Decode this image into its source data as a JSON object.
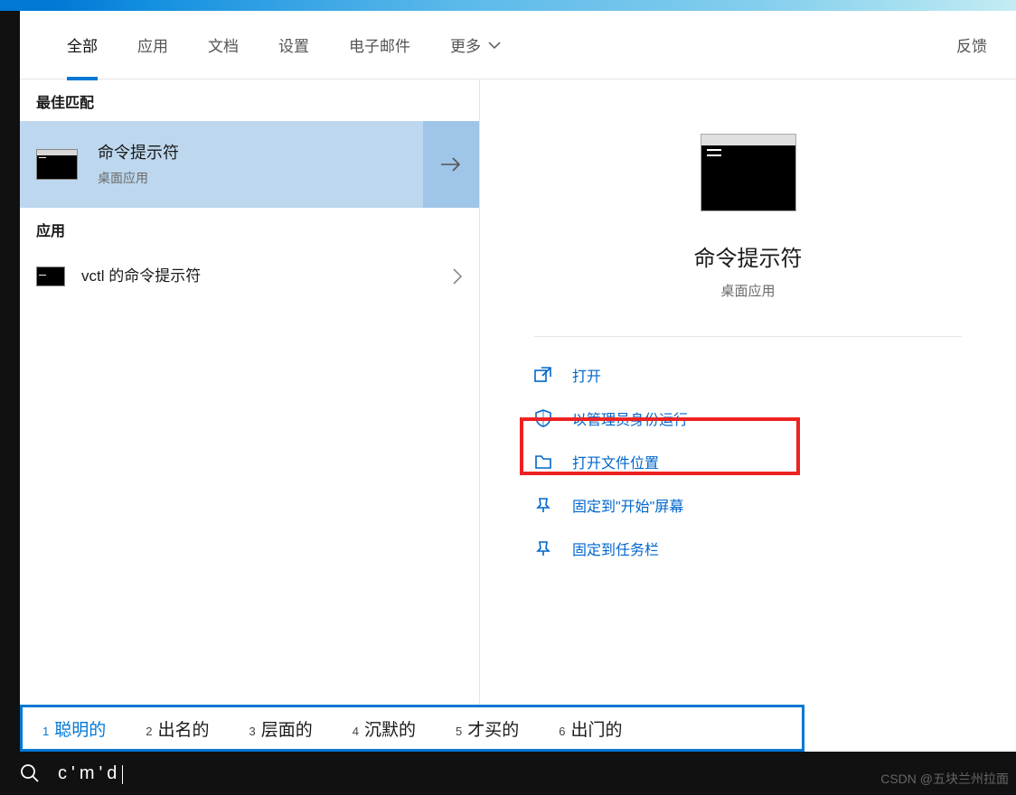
{
  "tabs": {
    "all": "全部",
    "apps": "应用",
    "docs": "文档",
    "settings": "设置",
    "email": "电子邮件",
    "more": "更多"
  },
  "feedback": "反馈",
  "sections": {
    "best_match": "最佳匹配",
    "apps_header": "应用"
  },
  "best_match": {
    "title": "命令提示符",
    "subtitle": "桌面应用"
  },
  "apps_list": [
    {
      "label": "vctl 的命令提示符"
    }
  ],
  "preview": {
    "title": "命令提示符",
    "subtitle": "桌面应用"
  },
  "actions": {
    "open": "打开",
    "run_as_admin": "以管理员身份运行",
    "open_file_location": "打开文件位置",
    "pin_start": "固定到\"开始\"屏幕",
    "pin_taskbar": "固定到任务栏"
  },
  "ime": {
    "candidates": [
      {
        "n": "1",
        "text": "聪明的"
      },
      {
        "n": "2",
        "text": "出名的"
      },
      {
        "n": "3",
        "text": "层面的"
      },
      {
        "n": "4",
        "text": "沉默的"
      },
      {
        "n": "5",
        "text": "才买的"
      },
      {
        "n": "6",
        "text": "出门的"
      }
    ]
  },
  "search_query": "c'm'd",
  "watermark": "CSDN @五块兰州拉面"
}
